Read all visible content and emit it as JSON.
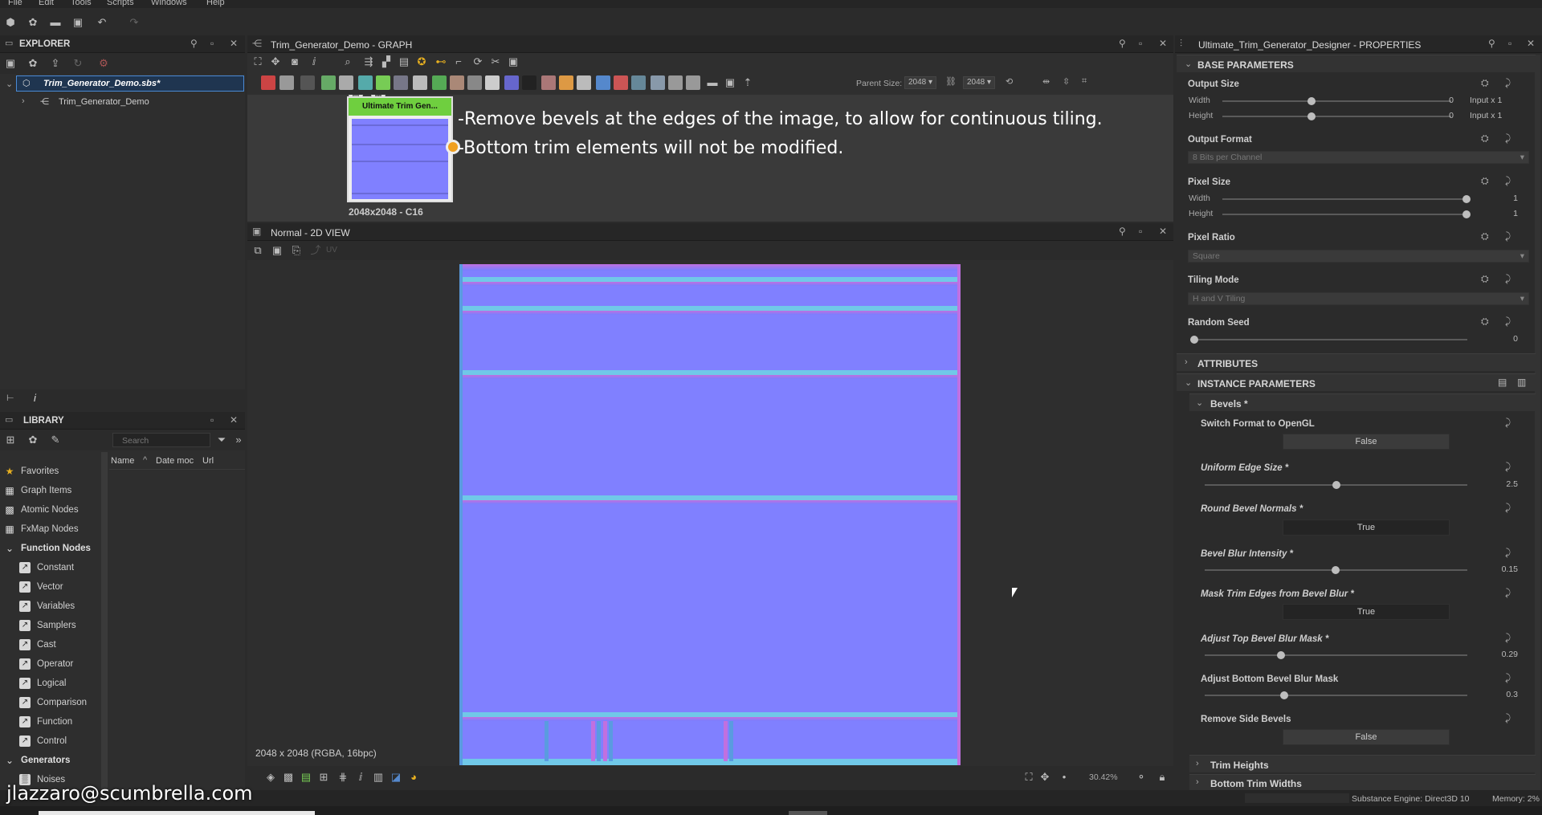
{
  "menu": [
    "File",
    "Edit",
    "Tools",
    "Scripts",
    "Windows",
    "Help"
  ],
  "explorer": {
    "title": "EXPLORER",
    "package": "Trim_Generator_Demo.sbs*",
    "graph": "Trim_Generator_Demo"
  },
  "library": {
    "title": "LIBRARY",
    "search_placeholder": "Search",
    "columns": [
      "Name",
      "Date moc",
      "Url"
    ],
    "items": [
      {
        "label": "Favorites",
        "icon": "★",
        "sub": false,
        "bold": false
      },
      {
        "label": "Graph Items",
        "icon": "▦",
        "sub": false,
        "bold": false
      },
      {
        "label": "Atomic Nodes",
        "icon": "▩",
        "sub": false,
        "bold": false
      },
      {
        "label": "FxMap Nodes",
        "icon": "▦",
        "sub": false,
        "bold": false
      },
      {
        "label": "Function Nodes",
        "icon": "⌄",
        "sub": false,
        "bold": true
      },
      {
        "label": "Constant",
        "icon": "↗",
        "sub": true
      },
      {
        "label": "Vector",
        "icon": "↗",
        "sub": true
      },
      {
        "label": "Variables",
        "icon": "↗",
        "sub": true
      },
      {
        "label": "Samplers",
        "icon": "↗",
        "sub": true
      },
      {
        "label": "Cast",
        "icon": "↗",
        "sub": true
      },
      {
        "label": "Operator",
        "icon": "↗",
        "sub": true
      },
      {
        "label": "Logical",
        "icon": "↗",
        "sub": true
      },
      {
        "label": "Comparison",
        "icon": "↗",
        "sub": true
      },
      {
        "label": "Function",
        "icon": "↗",
        "sub": true
      },
      {
        "label": "Control",
        "icon": "↗",
        "sub": true
      },
      {
        "label": "Generators",
        "icon": "⌄",
        "sub": false,
        "bold": true
      },
      {
        "label": "Noises",
        "icon": "▒",
        "sub": true
      }
    ]
  },
  "graph": {
    "title": "Trim_Generator_Demo - GRAPH",
    "parent_size_label": "Parent Size:",
    "parent_size_w": "2048",
    "parent_size_h": "2048",
    "node_title": "Ultimate Trim Gen...",
    "node_caption": "2048x2048 - C16",
    "comment_line1": "-Remove bevels at the edges of the image, to allow for continuous tiling.",
    "comment_line2": "-Bottom trim elements will not be modified."
  },
  "view2d": {
    "title": "Normal - 2D VIEW",
    "uv_label": "UV",
    "info": "2048 x 2048 (RGBA, 16bpc)",
    "zoom": "30.42%"
  },
  "properties": {
    "title": "Ultimate_Trim_Generator_Designer - PROPERTIES",
    "base_section": "BASE PARAMETERS",
    "attributes_section": "ATTRIBUTES",
    "instance_section": "INSTANCE PARAMETERS",
    "output_size": {
      "label": "Output Size",
      "width_label": "Width",
      "height_label": "Height",
      "width_value": "0",
      "height_value": "0",
      "width_suffix": "Input x 1",
      "height_suffix": "Input x 1"
    },
    "output_format": {
      "label": "Output Format",
      "value": "8 Bits per Channel"
    },
    "pixel_size": {
      "label": "Pixel Size",
      "width_label": "Width",
      "height_label": "Height",
      "width_value": "1",
      "height_value": "1"
    },
    "pixel_ratio": {
      "label": "Pixel Ratio",
      "value": "Square"
    },
    "tiling_mode": {
      "label": "Tiling Mode",
      "value": "H and V Tiling"
    },
    "random_seed": {
      "label": "Random Seed",
      "value": "0"
    },
    "bevels_group": "Bevels *",
    "switch_format": {
      "label": "Switch Format to OpenGL",
      "value": "False"
    },
    "uniform_edge": {
      "label": "Uniform Edge Size *",
      "value": "2.5"
    },
    "round_bevel": {
      "label": "Round Bevel Normals *",
      "value": "True"
    },
    "bevel_blur": {
      "label": "Bevel Blur Intensity *",
      "value": "0.15"
    },
    "mask_trim": {
      "label": "Mask Trim Edges from Bevel Blur *",
      "value": "True"
    },
    "adjust_top": {
      "label": "Adjust Top Bevel Blur Mask *",
      "value": "0.29"
    },
    "adjust_bottom": {
      "label": "Adjust Bottom Bevel Blur Mask",
      "value": "0.3"
    },
    "remove_side": {
      "label": "Remove Side Bevels",
      "value": "False"
    },
    "trim_heights": "Trim Heights",
    "bottom_trim_widths": "Bottom Trim Widths"
  },
  "status": {
    "engine": "Substance Engine: Direct3D 10",
    "memory": "Memory: 2%"
  },
  "watermark": "jlazzaro@scumbrella.com",
  "colors": {
    "accent": "#4a8ad4",
    "node_header": "#6fcf3f",
    "normal_base": "#8080ff",
    "port": "#f0a020"
  }
}
